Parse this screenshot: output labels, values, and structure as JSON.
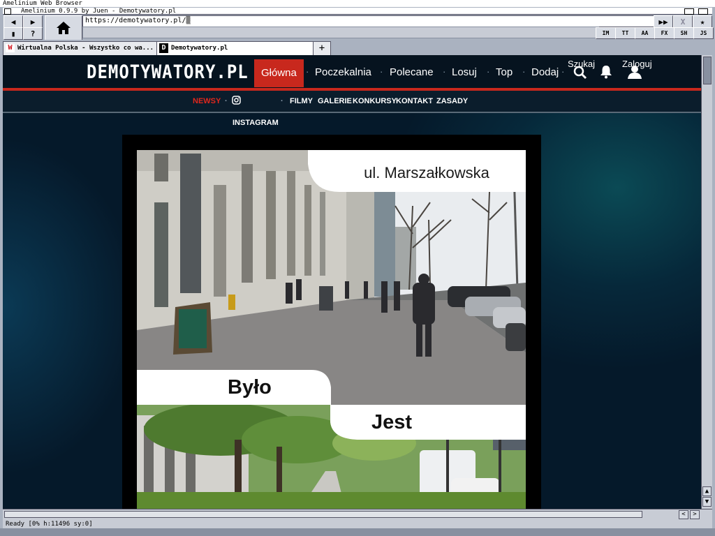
{
  "screen": {
    "title": "Amelinium Web Browser"
  },
  "window": {
    "title": "Amelinium 0.9.9 by Juen - Demotywatory.pl"
  },
  "toolbar": {
    "back_label": "◀",
    "forward_label": "▶",
    "bookmark_label": "▮",
    "help_label": "?",
    "fast_forward_label": "▶▶",
    "stop_label": "X",
    "favorite_label": "★",
    "url": "https://demotywatory.pl/▒",
    "chips": [
      "IM",
      "TT",
      "AA",
      "FX",
      "SH",
      "JS"
    ]
  },
  "tabs": [
    {
      "label": "Wirtualna Polska - Wszystko co wa...",
      "close": "✕"
    },
    {
      "label": "Demotywatory.pl",
      "close": "✕"
    }
  ],
  "new_tab_label": "+",
  "site": {
    "logo": "DEMOTYWATORY.PL",
    "nav": [
      "Główna",
      "Poczekalnia",
      "Polecane",
      "Losuj",
      "Top",
      "Dodaj"
    ],
    "search_label": "Szukaj",
    "login_label": "Zaloguj",
    "subnav": [
      "NEWSY",
      "FILMY",
      "GALERIE",
      "KONKURSY",
      "KONTAKT",
      "ZASADY"
    ],
    "instagram_label": "INSTAGRAM",
    "accent_color": "#c8281d"
  },
  "feature": {
    "street_label": "ul. Marszałkowska",
    "before_label": "Było",
    "after_label": "Jest"
  },
  "status": {
    "text": "Ready  [0% h:11496 sy:0]"
  }
}
